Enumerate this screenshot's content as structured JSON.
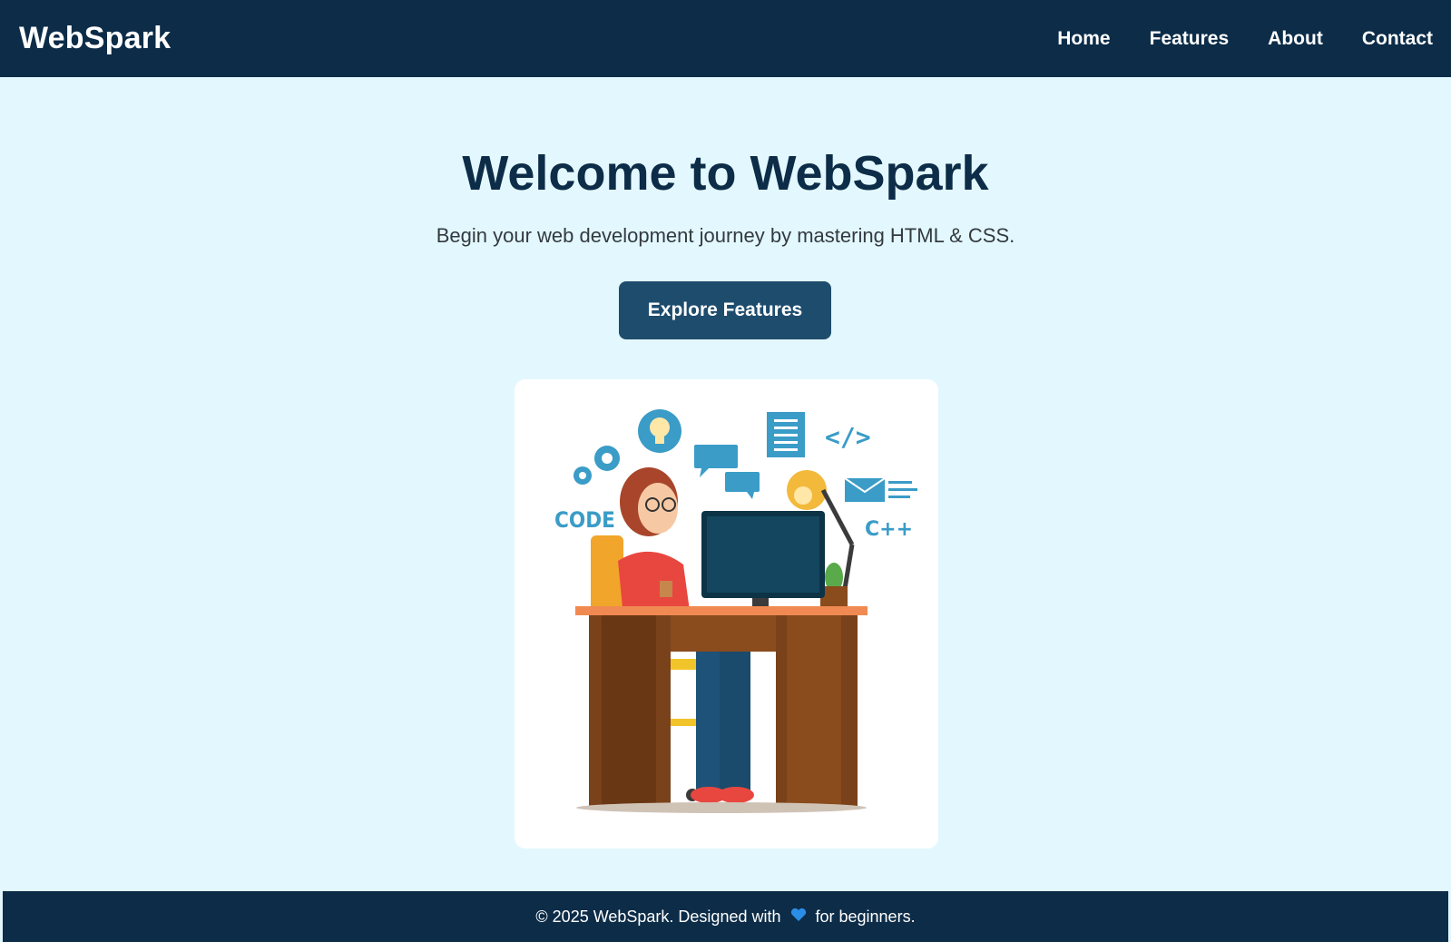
{
  "brand": "WebSpark",
  "nav": {
    "items": [
      {
        "label": "Home"
      },
      {
        "label": "Features"
      },
      {
        "label": "About"
      },
      {
        "label": "Contact"
      }
    ]
  },
  "hero": {
    "title": "Welcome to WebSpark",
    "subtitle": "Begin your web development journey by mastering HTML & CSS.",
    "cta_label": "Explore Features"
  },
  "illustration": {
    "code_label": "CODE",
    "tag_label": "</>",
    "cpp_label": "C++"
  },
  "footer": {
    "text_before": "© 2025 WebSpark. Designed with",
    "heart_icon": "heart-icon",
    "text_after": "for beginners."
  },
  "colors": {
    "navbar": "#0c2c48",
    "background": "#e3f8fe",
    "button": "#1e4c6d",
    "heart": "#2b8ee6"
  }
}
